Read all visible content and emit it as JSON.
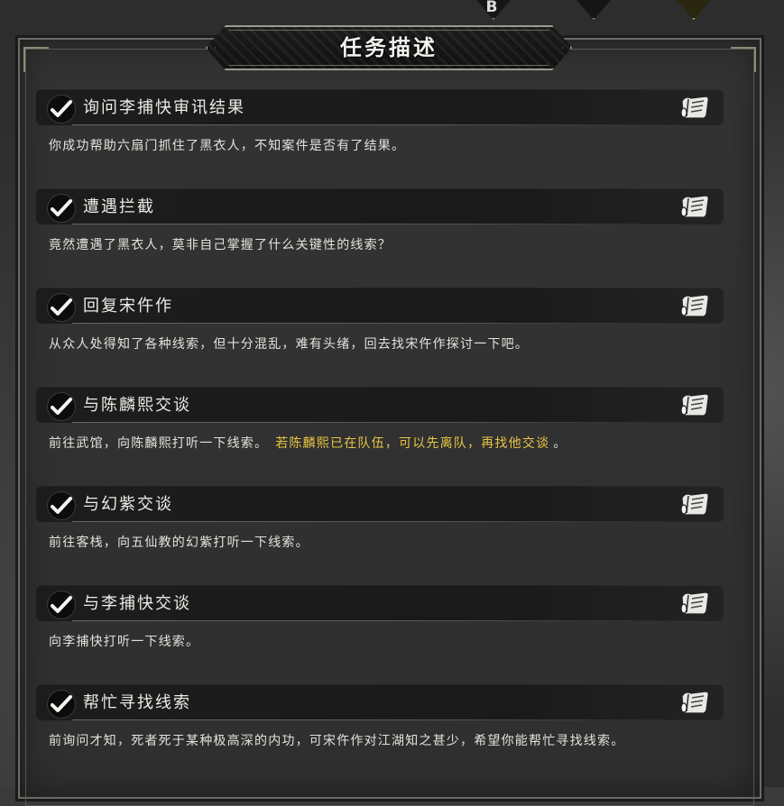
{
  "tabs": [
    {
      "label": "B"
    },
    {
      "label": ""
    },
    {
      "label": ""
    }
  ],
  "panel": {
    "title": "任务描述"
  },
  "quests": [
    {
      "title": "询问李捕快审讯结果",
      "desc_main": "你成功帮助六扇门抓住了黑衣人，不知案件是否有了结果。",
      "desc_highlight": "",
      "desc_tail": ""
    },
    {
      "title": "遭遇拦截",
      "desc_main": "竟然遭遇了黑衣人，莫非自己掌握了什么关键性的线索？",
      "desc_highlight": "",
      "desc_tail": ""
    },
    {
      "title": "回复宋仵作",
      "desc_main": "从众人处得知了各种线索，但十分混乱，难有头绪，回去找宋仵作探讨一下吧。",
      "desc_highlight": "",
      "desc_tail": ""
    },
    {
      "title": "与陈麟熙交谈",
      "desc_main": "前往武馆，向陈麟熙打听一下线索。",
      "desc_highlight": "若陈麟熙已在队伍，可以先离队，再找他交谈",
      "desc_tail": "。"
    },
    {
      "title": "与幻紫交谈",
      "desc_main": "前往客栈，向五仙教的幻紫打听一下线索。",
      "desc_highlight": "",
      "desc_tail": ""
    },
    {
      "title": "与李捕快交谈",
      "desc_main": "向李捕快打听一下线索。",
      "desc_highlight": "",
      "desc_tail": ""
    },
    {
      "title": "帮忙寻找线索",
      "desc_main": "前询问才知，死者死于某种极高深的内功，可宋仵作对江湖知之甚少，希望你能帮忙寻找线索。",
      "desc_highlight": "",
      "desc_tail": ""
    }
  ],
  "colors": {
    "highlight": "#e6c642",
    "text": "#e2e2dc",
    "header_bg": "#1c1c1c"
  },
  "icons": {
    "check": "check-icon",
    "scroll": "scroll-icon"
  }
}
